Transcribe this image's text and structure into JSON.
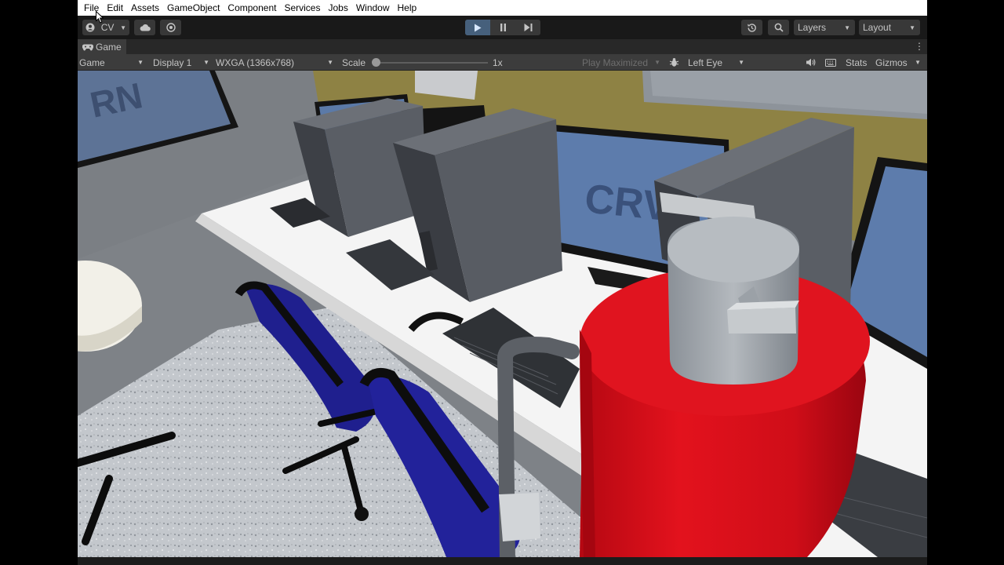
{
  "menu": [
    "File",
    "Edit",
    "Assets",
    "GameObject",
    "Component",
    "Services",
    "Jobs",
    "Window",
    "Help"
  ],
  "toolbar": {
    "account_label": "CV",
    "layers_label": "Layers",
    "layout_label": "Layout"
  },
  "tab": {
    "label": "Game"
  },
  "game_toolbar": {
    "view_mode": "Game",
    "display": "Display 1",
    "resolution": "WXGA (1366x768)",
    "scale_label": "Scale",
    "scale_value": "1x",
    "scale_fraction": 0.0,
    "play_mode": "Play Maximized",
    "eye": "Left Eye",
    "stats_label": "Stats",
    "gizmos_label": "Gizmos"
  },
  "colors": {
    "accent_play": "#46607c",
    "menu_bg": "#ffffff",
    "toolbar_bg": "#191919",
    "panel_bg": "#3c3c3c",
    "wall_yellow": "#8e8244",
    "extinguisher_red": "#d60f1a",
    "chair_blue": "#1f1f8e"
  },
  "scene": {
    "monitor_logo_text": "CRV",
    "left_logo_text": "RN"
  }
}
